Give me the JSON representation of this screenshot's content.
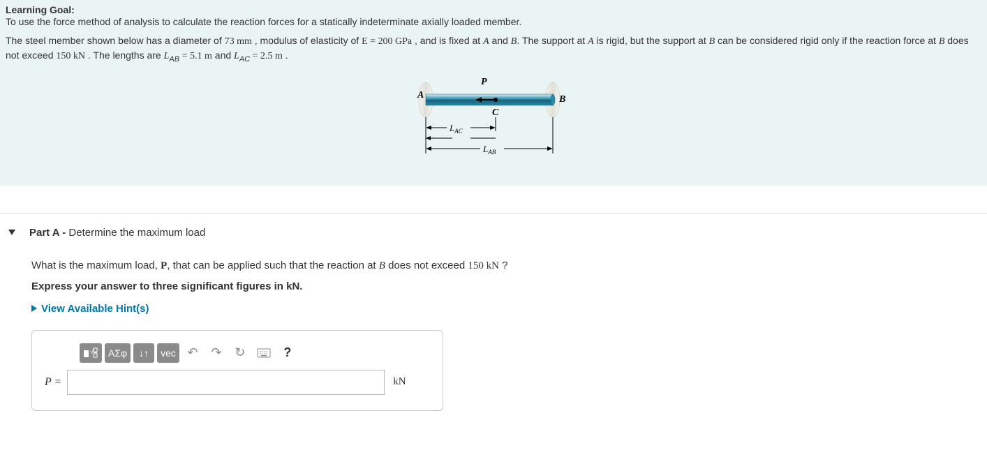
{
  "learning_goal_label": "Learning Goal:",
  "learning_goal_text": "To use the force method of analysis to calculate the reaction forces for a statically indeterminate axially loaded member.",
  "problem": {
    "pre": "The steel member shown below has a diameter of ",
    "diameter": "73 mm",
    "mid1": " , modulus of elasticity of ",
    "E_eq": "E = 200 GPa",
    "mid2": " , and is fixed at ",
    "A": "A",
    "and": " and ",
    "B": "B",
    "mid3": ". The support at ",
    "mid4": " is rigid, but the support at ",
    "mid5": " can be considered rigid only if the reaction force at ",
    "mid6": " does not exceed ",
    "force_limit": "150 kN",
    "mid7": " . The lengths are ",
    "L_AB": "L",
    "L_AB_sub": "AB",
    "L_AB_val": " = 5.1 m",
    "mid8": " and ",
    "L_AC": "L",
    "L_AC_sub": "AC",
    "L_AC_val": " = 2.5 m",
    "end": " ."
  },
  "diagram": {
    "A": "A",
    "B": "B",
    "C": "C",
    "P": "P",
    "LAC": "L",
    "LAC_sub": "AC",
    "LAB": "L",
    "LAB_sub": "AB"
  },
  "partA": {
    "label_bold": "Part A - ",
    "label_rest": "Determine the maximum load",
    "question_pre": "What is the maximum load, ",
    "P_bold": "P",
    "question_mid": ", that can be applied such that the reaction at ",
    "B": "B",
    "question_mid2": " does not exceed ",
    "limit": "150 kN",
    "question_end": " ?",
    "express": "Express your answer to three significant figures in kN.",
    "hints": "View Available Hint(s)",
    "toolbar": {
      "templates": "■√☐",
      "greek": "ΑΣφ",
      "updown": "↓↑",
      "vec": "vec",
      "undo": "↶",
      "redo": "↷",
      "reset": "↻",
      "keyboard": "⌨",
      "help": "?"
    },
    "answer_label": "P =",
    "answer_value": "",
    "unit": "kN"
  }
}
